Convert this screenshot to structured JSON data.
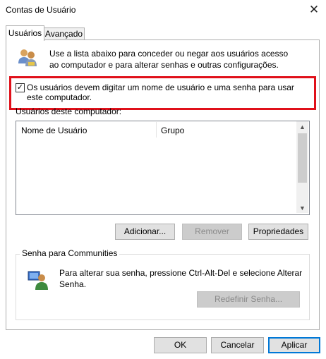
{
  "window": {
    "title": "Contas de Usuário"
  },
  "tabs": [
    {
      "label": "Usuários",
      "selected": true
    },
    {
      "label": "Avançado",
      "selected": false
    }
  ],
  "intro": {
    "text": "Use a lista abaixo para conceder ou negar aos usuários acesso ao computador e para alterar senhas e outras configurações."
  },
  "checkbox": {
    "checked": true,
    "label": "Os usuários devem digitar um nome de usuário e uma senha para usar este computador."
  },
  "users": {
    "label": "Usuários deste computador:",
    "columns": [
      "Nome de Usuário",
      "Grupo"
    ],
    "rows": []
  },
  "buttons": {
    "add": "Adicionar...",
    "remove": "Remover",
    "properties": "Propriedades",
    "reset_password": "Redefinir Senha...",
    "ok": "OK",
    "cancel": "Cancelar",
    "apply": "Aplicar"
  },
  "password_group": {
    "title": "Senha para Communities",
    "text": "Para alterar sua senha, pressione Ctrl-Alt-Del e selecione Alterar Senha."
  },
  "colors": {
    "highlight": "#e0101a",
    "accent": "#0078d7"
  },
  "icons": {
    "users": "users-icon",
    "user_key": "user-icon",
    "close": "close-icon"
  }
}
